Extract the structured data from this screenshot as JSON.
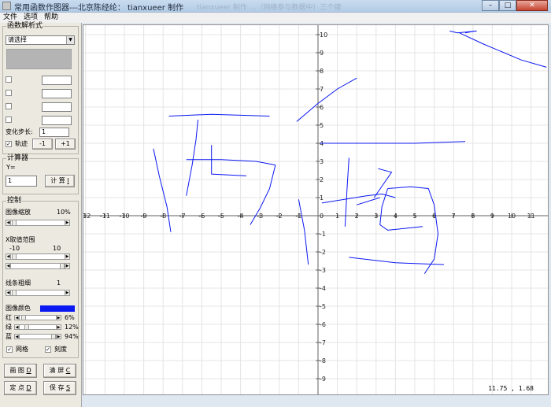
{
  "window": {
    "title": "常用函数作图器---北京陈经纶： tianxueer 制作",
    "title_ghost": "tianxueer 制作 ...（网络参与数据中）三个键",
    "min_label": "–",
    "max_label": "□",
    "close_label": "✕"
  },
  "menu": [
    "文件",
    "选项",
    "帮助"
  ],
  "func_group": {
    "title": "函数解析式",
    "select_value": "请选择",
    "step_label": "变化步长:",
    "step_value": "1",
    "trace_label": "轨迹",
    "minus_label": "-1",
    "plus_label": "+1"
  },
  "calc_group": {
    "title": "计算器",
    "y_label": "Y=",
    "x_value": "1",
    "calc_button": "计 算",
    "calc_key": "I"
  },
  "control_group": {
    "title": "控制",
    "zoom_label": "图像缩放",
    "zoom_value": "10%",
    "xrange_label": "X取值范围",
    "xmin_value": "-10",
    "xmax_value": "10",
    "linewidth_label": "线条粗细",
    "linewidth_value": "1",
    "color_label": "图像颜色",
    "red_label": "红",
    "red_value": "6%",
    "red_pct": 6,
    "green_label": "绿",
    "green_value": "12%",
    "green_pct": 12,
    "blue_label": "蓝",
    "blue_value": "94%",
    "blue_pct": 94,
    "grid_label": "网格",
    "tick_label": "刻度"
  },
  "buttons": {
    "draw": "画 图",
    "draw_key": "D",
    "clear": "清 屏",
    "clear_key": "C",
    "point": "定 点",
    "point_key": "D",
    "save": "保 存",
    "save_key": "S"
  },
  "colors": {
    "curve": "#0a18f2",
    "grid": "#e4e4e4",
    "axis": "#606060"
  },
  "plot": {
    "x_ticks": [
      -12,
      -11,
      -10,
      -9,
      -8,
      -7,
      -6,
      -5,
      -4,
      -3,
      -2,
      -1,
      1,
      2,
      3,
      4,
      5,
      6,
      7,
      8,
      9,
      10,
      11
    ],
    "y_ticks": [
      10,
      9,
      8,
      7,
      6,
      5,
      4,
      3,
      2,
      1,
      -1,
      -2,
      -3,
      -4,
      -5,
      -6,
      -7,
      -8,
      -9
    ],
    "origin_label": "0",
    "x_range": [
      -12,
      11.75
    ],
    "y_range": [
      -10,
      10.2
    ],
    "strokes": [
      [
        [
          6.8,
          10.2
        ],
        [
          7.2,
          10.1
        ],
        [
          8.2,
          10.2
        ]
      ],
      [
        [
          7.3,
          10.1
        ],
        [
          8.5,
          9.5
        ],
        [
          10.5,
          8.6
        ],
        [
          11.8,
          8.2
        ]
      ],
      [
        [
          7.6,
          10.1
        ],
        [
          8.1,
          10.2
        ]
      ],
      [
        [
          -7.7,
          5.5
        ],
        [
          -5.5,
          5.6
        ],
        [
          -2.5,
          5.5
        ]
      ],
      [
        [
          -1.1,
          5.2
        ],
        [
          0,
          6.2
        ],
        [
          1,
          7
        ],
        [
          2,
          7.6
        ]
      ],
      [
        [
          0.1,
          4.0
        ],
        [
          3,
          4.0
        ],
        [
          5,
          4.0
        ],
        [
          7.6,
          4.1
        ]
      ],
      [
        [
          -8.5,
          3.7
        ],
        [
          -8.2,
          2.2
        ],
        [
          -7.8,
          0.5
        ],
        [
          -7.6,
          -0.9
        ]
      ],
      [
        [
          -6.8,
          1.1
        ],
        [
          -6.5,
          2.8
        ],
        [
          -6.3,
          4.2
        ],
        [
          -6.2,
          5.3
        ]
      ],
      [
        [
          -6.8,
          3.1
        ],
        [
          -5,
          3.1
        ],
        [
          -3.2,
          3.0
        ],
        [
          -2.2,
          2.8
        ]
      ],
      [
        [
          -5.5,
          3.9
        ],
        [
          -5.5,
          2.3
        ],
        [
          -3.7,
          2.2
        ]
      ],
      [
        [
          -2.2,
          2.8
        ],
        [
          -2.5,
          1.5
        ],
        [
          -3.0,
          0.4
        ],
        [
          -3.5,
          -0.5
        ]
      ],
      [
        [
          -1.0,
          0.9
        ],
        [
          -0.7,
          -0.8
        ],
        [
          -0.5,
          -2.7
        ]
      ],
      [
        [
          0.2,
          0.7
        ],
        [
          2.5,
          1.1
        ],
        [
          3.3,
          1.2
        ],
        [
          4.0,
          1.0
        ]
      ],
      [
        [
          1.6,
          3.2
        ],
        [
          1.5,
          1.5
        ],
        [
          1.4,
          -0.6
        ]
      ],
      [
        [
          2.9,
          1.0
        ],
        [
          3.8,
          2.4
        ],
        [
          3.1,
          2.6
        ]
      ],
      [
        [
          3.6,
          1.5
        ],
        [
          4.8,
          1.6
        ],
        [
          5.7,
          1.5
        ],
        [
          6.0,
          0.6
        ],
        [
          6.2,
          -1.0
        ],
        [
          6.0,
          -2.4
        ],
        [
          5.5,
          -3.2
        ]
      ],
      [
        [
          3.6,
          1.5
        ],
        [
          3.3,
          0.5
        ],
        [
          3.2,
          -0.5
        ],
        [
          3.6,
          -0.8
        ],
        [
          4.5,
          -0.7
        ],
        [
          5.4,
          -0.6
        ]
      ],
      [
        [
          1.6,
          -2.3
        ],
        [
          4.0,
          -2.6
        ],
        [
          6.5,
          -2.7
        ]
      ],
      [
        [
          2.0,
          0.6
        ],
        [
          3.2,
          1.0
        ]
      ]
    ]
  },
  "coords_display": "11.75 , 1.68"
}
